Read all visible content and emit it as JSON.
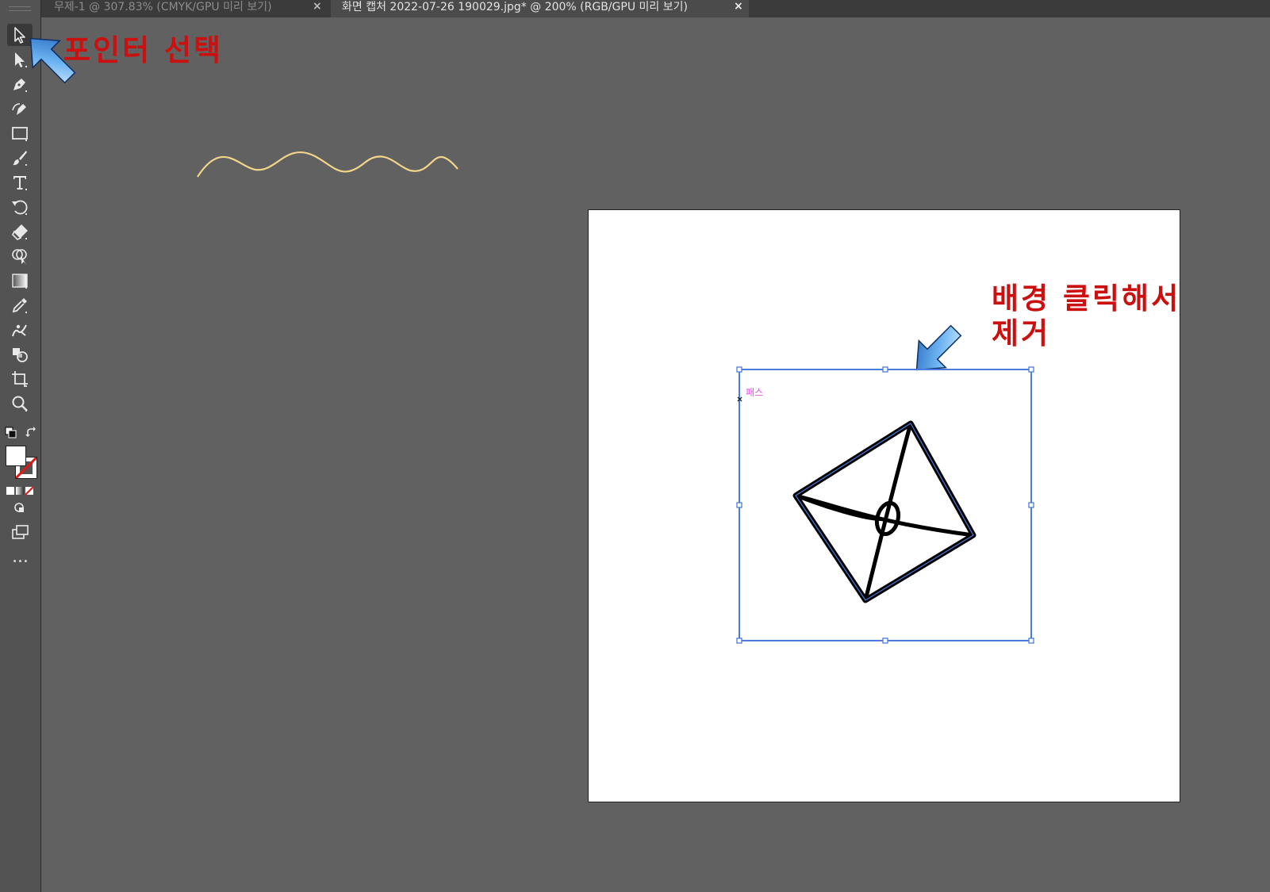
{
  "tabs": [
    {
      "label": "무제-1 @ 307.83% (CMYK/GPU 미리 보기)",
      "close": "×",
      "active": false
    },
    {
      "label": "화면 캡처 2022-07-26 190029.jpg* @ 200% (RGB/GPU 미리 보기)",
      "close": "×",
      "active": true
    }
  ],
  "toolbar": {
    "tools": [
      {
        "icon": "selection-tool-icon"
      },
      {
        "icon": "direct-selection-tool-icon"
      },
      {
        "icon": "pen-tool-icon"
      },
      {
        "icon": "curvature-tool-icon"
      },
      {
        "icon": "rectangle-tool-icon"
      },
      {
        "icon": "paintbrush-tool-icon"
      },
      {
        "icon": "type-tool-icon",
        "glyph": "T"
      },
      {
        "icon": "rotate-tool-icon"
      },
      {
        "icon": "eraser-tool-icon"
      },
      {
        "icon": "shape-builder-tool-icon"
      },
      {
        "icon": "gradient-tool-icon"
      },
      {
        "icon": "eyedropper-tool-icon"
      },
      {
        "icon": "puppet-warp-tool-icon"
      },
      {
        "icon": "live-paint-tool-icon"
      },
      {
        "icon": "artboard-tool-icon"
      },
      {
        "icon": "zoom-tool-icon"
      }
    ],
    "more": "•••"
  },
  "annotations": {
    "pointer_select": "포인터 선택",
    "remove_bg_line1": "배경 클릭해서",
    "remove_bg_line2": "제거"
  },
  "selection": {
    "label": "패스"
  },
  "colors": {
    "canvas_bg": "#616161",
    "toolbar_bg": "#535353",
    "annotation_red": "#cc1010",
    "selection_blue": "#4b7bdc",
    "path_label": "#e04de0",
    "wave_stroke": "#f2d58a"
  }
}
